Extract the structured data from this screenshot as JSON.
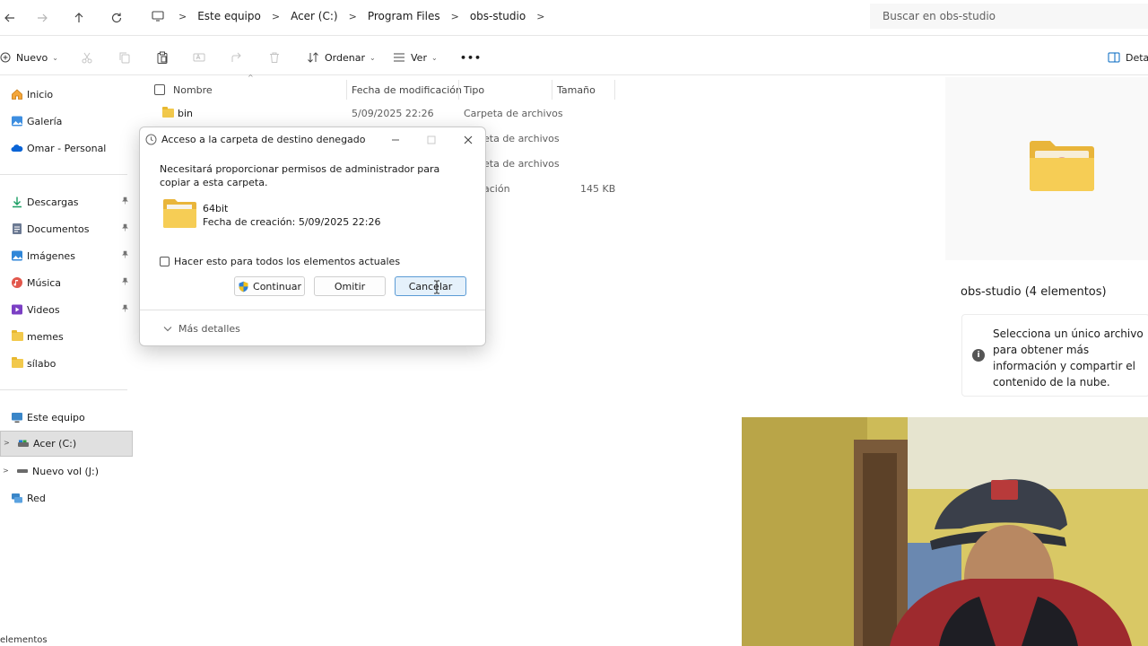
{
  "address": {
    "crumbs": [
      "Este equipo",
      "Acer (C:)",
      "Program Files",
      "obs-studio"
    ],
    "search_placeholder": "Buscar en obs-studio"
  },
  "toolbar": {
    "new_label": "Nuevo",
    "sort_label": "Ordenar",
    "view_label": "Ver",
    "more_label": "•••",
    "details_label": "Detal"
  },
  "sidebar": {
    "items": [
      {
        "label": "Inicio",
        "icon": "home-icon"
      },
      {
        "label": "Galería",
        "icon": "gallery-icon"
      },
      {
        "label": "Omar - Personal",
        "icon": "onedrive-icon"
      },
      {
        "label": "Descargas",
        "icon": "download-icon"
      },
      {
        "label": "Documentos",
        "icon": "documents-icon"
      },
      {
        "label": "Imágenes",
        "icon": "pictures-icon"
      },
      {
        "label": "Música",
        "icon": "music-icon"
      },
      {
        "label": "Videos",
        "icon": "videos-icon"
      },
      {
        "label": "memes",
        "icon": "folder-icon"
      },
      {
        "label": "sílabo",
        "icon": "folder-icon"
      },
      {
        "label": "Este equipo",
        "icon": "computer-icon"
      },
      {
        "label": "Acer (C:)",
        "icon": "drive-icon"
      },
      {
        "label": "Nuevo vol (J:)",
        "icon": "drive-icon"
      },
      {
        "label": "Red",
        "icon": "network-icon"
      }
    ],
    "pin_glyph": "📌"
  },
  "list": {
    "columns": {
      "name": "Nombre",
      "modified": "Fecha de modificación",
      "type": "Tipo",
      "size": "Tamaño"
    },
    "rows": [
      {
        "name": "bin",
        "modified": "5/09/2025 22:26",
        "type": "Carpeta de archivos",
        "size": ""
      },
      {
        "name": "",
        "modified": "",
        "type": "eta de archivos",
        "size": ""
      },
      {
        "name": "",
        "modified": "",
        "type": "eta de archivos",
        "size": ""
      },
      {
        "name": "",
        "modified": "",
        "type": "ación",
        "size": "145 KB"
      }
    ]
  },
  "details": {
    "title": "obs-studio (4 elementos)",
    "info": "Selecciona un único archivo para obtener más información y compartir el contenido de la nube."
  },
  "dialog": {
    "title": "Acceso a la carpeta de destino denegado",
    "message": "Necesitará proporcionar permisos de administrador para copiar a esta carpeta.",
    "folder_name": "64bit",
    "folder_date": "Fecha de creación: 5/09/2025 22:26",
    "checkbox_label": "Hacer esto para todos los elementos actuales",
    "continue_label": "Continuar",
    "skip_label": "Omitir",
    "cancel_label": "Cancelar",
    "more_details_label": "Más detalles"
  },
  "status": {
    "text": "elementos"
  },
  "colors": {
    "accent": "#0067c0",
    "folder": "#f2c94c",
    "selected": "#e0e0e0"
  }
}
